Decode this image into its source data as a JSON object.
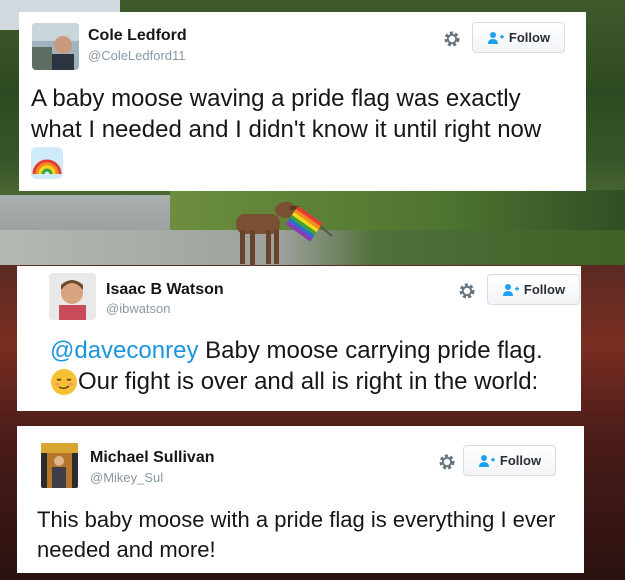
{
  "tweets": [
    {
      "name": "Cole Ledford",
      "handle": "@ColeLedford11",
      "follow_label": "Follow",
      "text": "A baby moose waving a pride flag was exactly what I needed and I didn't know it until right now",
      "emoji": "rainbow"
    },
    {
      "name": "Isaac B Watson",
      "handle": "@ibwatson",
      "follow_label": "Follow",
      "mention": "@daveconrey",
      "text_line1": " Baby moose carrying pride flag.",
      "emoji": "relieved-face",
      "text_line2": " Our fight is over and all is right in the world:"
    },
    {
      "name": "Michael Sullivan",
      "handle": "@Mikey_Sul",
      "follow_label": "Follow",
      "text": "This baby moose with a pride flag is everything I ever needed and more!"
    }
  ],
  "colors": {
    "link": "#1b95e0",
    "handle": "#8899a6",
    "follow_accent": "#1da1f2"
  }
}
